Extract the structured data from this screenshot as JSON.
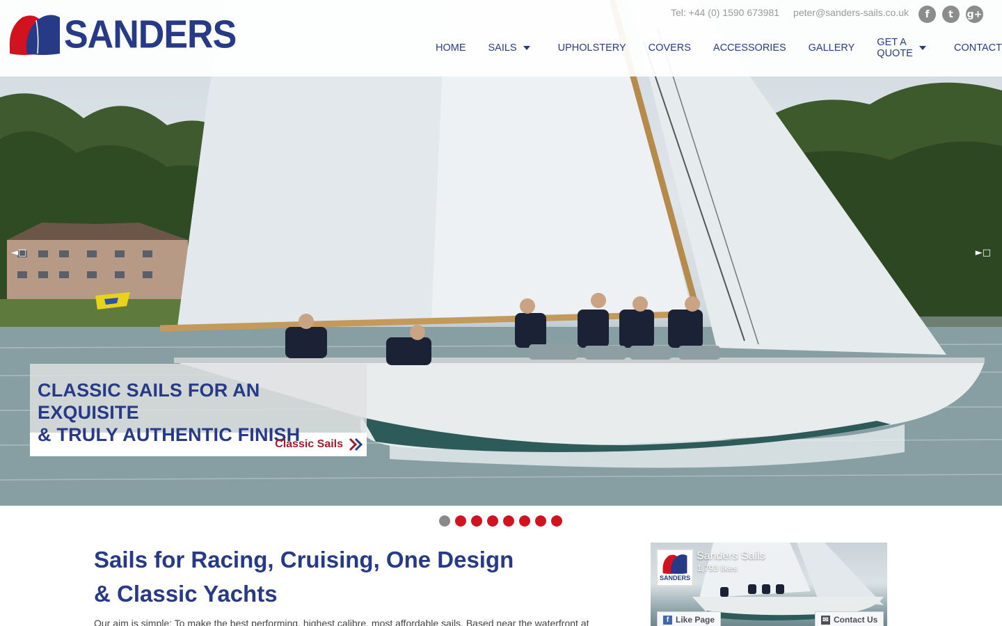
{
  "brand": {
    "name": "SANDERS",
    "colors": {
      "navy": "#273a86",
      "red": "#d1121f",
      "link_red": "#a31c2c"
    }
  },
  "header": {
    "tel": "Tel: +44 (0) 1590 673981",
    "email": "peter@sanders-sails.co.uk",
    "social": [
      {
        "icon": "facebook-icon",
        "glyph": "f"
      },
      {
        "icon": "twitter-icon",
        "glyph": "t"
      },
      {
        "icon": "google-plus-icon",
        "glyph": "g+"
      }
    ]
  },
  "nav": {
    "items": [
      {
        "label": "HOME",
        "dropdown": false
      },
      {
        "label": "SAILS",
        "dropdown": true
      },
      {
        "label": "UPHOLSTERY",
        "dropdown": false
      },
      {
        "label": "COVERS",
        "dropdown": false
      },
      {
        "label": "ACCESSORIES",
        "dropdown": false
      },
      {
        "label": "GALLERY",
        "dropdown": false
      },
      {
        "label": "GET A QUOTE",
        "dropdown": true
      },
      {
        "label": "CONTACT",
        "dropdown": false
      }
    ]
  },
  "slider": {
    "prev_glyph": "◄□",
    "next_glyph": "►□",
    "caption_line1": "CLASSIC SAILS FOR AN EXQUISITE",
    "caption_line2": "& TRULY AUTHENTIC FINISH",
    "caption_link": "Classic Sails",
    "dot_count": 8,
    "active_dot": 0
  },
  "main": {
    "title_line1": "Sails for Racing, Cruising, One Design",
    "title_line2": "& Classic Yachts",
    "intro": "Our aim is simple: To make the best performing, highest calibre, most affordable sails. Based near the waterfront at"
  },
  "facebook": {
    "page_name": "Sanders Sails",
    "likes": "1,793 likes",
    "avatar_text": "SANDERS",
    "like_button": "Like Page",
    "contact_button": "Contact Us"
  }
}
